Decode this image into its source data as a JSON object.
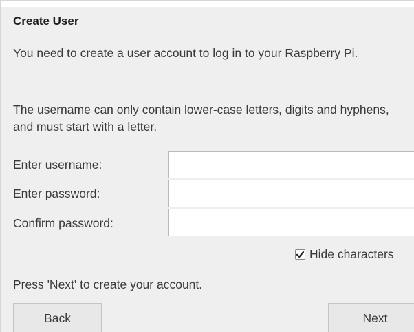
{
  "dialog": {
    "title": "Create User",
    "intro": "You need to create a user account to log in to your Raspberry Pi.",
    "rules": "The username can only contain lower-case letters, digits and hyphens, and must start with a letter.",
    "fields": {
      "username": {
        "label": "Enter username:",
        "value": "",
        "placeholder": ""
      },
      "password": {
        "label": "Enter password:",
        "value": "",
        "placeholder": ""
      },
      "confirm": {
        "label": "Confirm password:",
        "value": "",
        "placeholder": ""
      }
    },
    "hide_characters": {
      "label": "Hide characters",
      "checked": true
    },
    "footer": "Press 'Next' to create your account.",
    "buttons": {
      "back": "Back",
      "next": "Next"
    }
  }
}
